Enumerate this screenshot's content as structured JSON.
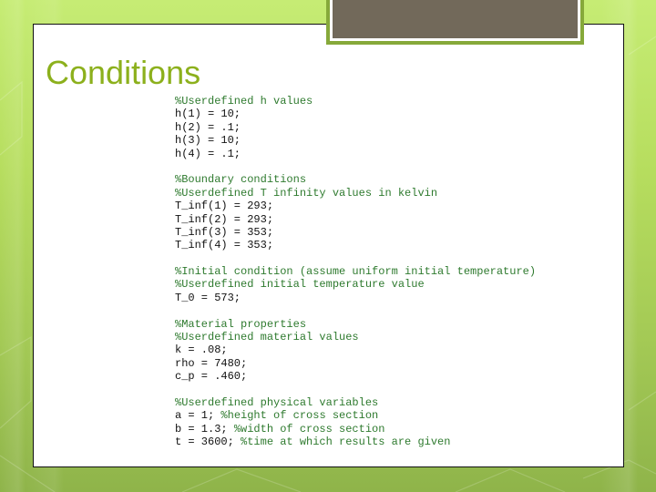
{
  "slide": {
    "title": "Conditions",
    "code_blocks": [
      {
        "lines": [
          {
            "code": "",
            "comment": "%Userdefined h values"
          },
          {
            "code": "h(1) = 10;",
            "comment": ""
          },
          {
            "code": "h(2) = .1;",
            "comment": ""
          },
          {
            "code": "h(3) = 10;",
            "comment": ""
          },
          {
            "code": "h(4) = .1;",
            "comment": ""
          }
        ]
      },
      {
        "lines": [
          {
            "code": "",
            "comment": "%Boundary conditions"
          },
          {
            "code": "",
            "comment": "%Userdefined T infinity values in kelvin"
          },
          {
            "code": "T_inf(1) = 293;",
            "comment": ""
          },
          {
            "code": "T_inf(2) = 293;",
            "comment": ""
          },
          {
            "code": "T_inf(3) = 353;",
            "comment": ""
          },
          {
            "code": "T_inf(4) = 353;",
            "comment": ""
          }
        ]
      },
      {
        "lines": [
          {
            "code": "",
            "comment": "%Initial condition (assume uniform initial temperature)"
          },
          {
            "code": "",
            "comment": "%Userdefined initial temperature value"
          },
          {
            "code": "T_0 = 573;",
            "comment": ""
          }
        ]
      },
      {
        "lines": [
          {
            "code": "",
            "comment": "%Material properties"
          },
          {
            "code": "",
            "comment": "%Userdefined material values"
          },
          {
            "code": "k = .08;",
            "comment": ""
          },
          {
            "code": "rho = 7480;",
            "comment": ""
          },
          {
            "code": "c_p = .460;",
            "comment": ""
          }
        ]
      },
      {
        "lines": [
          {
            "code": "",
            "comment": "%Userdefined physical variables"
          },
          {
            "code": "a = 1; ",
            "comment": "%height of cross section"
          },
          {
            "code": "b = 1.3; ",
            "comment": "%width of cross section"
          },
          {
            "code": "t = 3600; ",
            "comment": "%time at which results are given"
          }
        ]
      }
    ]
  },
  "colors": {
    "title": "#8cb01c",
    "comment": "#2e7a2e",
    "code": "#111111",
    "title_box_fill": "#72695a",
    "title_box_border": "#86a93a"
  }
}
